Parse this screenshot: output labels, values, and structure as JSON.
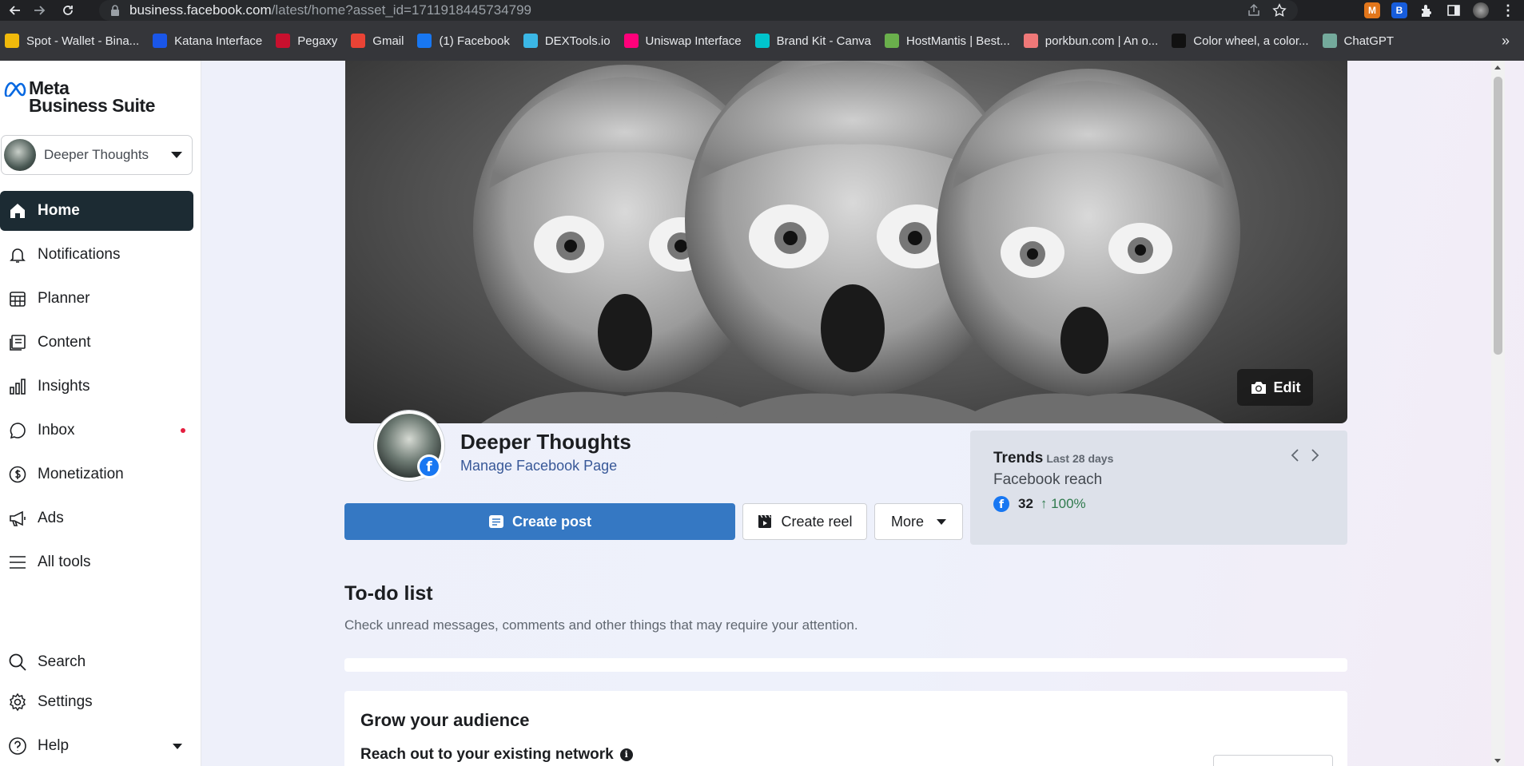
{
  "browser": {
    "url_host": "business.facebook.com",
    "url_path": "/latest/home?asset_id=1711918445734799",
    "bookmarks": [
      {
        "label": "Spot - Wallet - Bina...",
        "color": "#f0b90b",
        "icon": "binance-icon"
      },
      {
        "label": "Katana Interface",
        "color": "#1a56e8",
        "icon": "katana-icon"
      },
      {
        "label": "Pegaxy",
        "color": "#c8102e",
        "icon": "pegaxy-icon"
      },
      {
        "label": "Gmail",
        "color": "#ea4335",
        "icon": "gmail-icon"
      },
      {
        "label": "(1) Facebook",
        "color": "#1877f2",
        "icon": "facebook-icon"
      },
      {
        "label": "DEXTools.io",
        "color": "#3bb7e6",
        "icon": "dextools-icon"
      },
      {
        "label": "Uniswap Interface",
        "color": "#ff007a",
        "icon": "uniswap-icon"
      },
      {
        "label": "Brand Kit - Canva",
        "color": "#00c4cc",
        "icon": "canva-icon"
      },
      {
        "label": "HostMantis | Best...",
        "color": "#6ab04c",
        "icon": "hostmantis-icon"
      },
      {
        "label": "porkbun.com | An o...",
        "color": "#ef7878",
        "icon": "porkbun-icon"
      },
      {
        "label": "Color wheel, a color...",
        "color": "#111111",
        "icon": "colorwheel-icon"
      },
      {
        "label": "ChatGPT",
        "color": "#74aa9c",
        "icon": "chatgpt-icon"
      }
    ],
    "more_label": "»"
  },
  "sidebar": {
    "logo_line1": "Meta",
    "logo_line2": "Business Suite",
    "account_name": "Deeper Thoughts",
    "items": [
      {
        "label": "Home",
        "icon": "home-icon",
        "active": true
      },
      {
        "label": "Notifications",
        "icon": "bell-icon"
      },
      {
        "label": "Planner",
        "icon": "calendar-icon"
      },
      {
        "label": "Content",
        "icon": "content-icon"
      },
      {
        "label": "Insights",
        "icon": "bar-chart-icon"
      },
      {
        "label": "Inbox",
        "icon": "chat-icon",
        "badge": true
      },
      {
        "label": "Monetization",
        "icon": "dollar-icon"
      },
      {
        "label": "Ads",
        "icon": "megaphone-icon"
      },
      {
        "label": "All tools",
        "icon": "menu-icon"
      }
    ],
    "bottom_items": [
      {
        "label": "Search",
        "icon": "search-icon"
      },
      {
        "label": "Settings",
        "icon": "gear-icon"
      },
      {
        "label": "Help",
        "icon": "help-icon"
      }
    ]
  },
  "main": {
    "cover_edit_label": "Edit",
    "page_name": "Deeper Thoughts",
    "manage_link": "Manage Facebook Page",
    "create_post_label": "Create post",
    "create_reel_label": "Create reel",
    "more_label": "More",
    "trends": {
      "title": "Trends",
      "period": "Last 28 days",
      "metric": "Facebook reach",
      "value": "32",
      "change": "100%"
    },
    "todo": {
      "title": "To-do list",
      "subtitle": "Check unread messages, comments and other things that may require your attention."
    },
    "grow": {
      "title": "Grow your audience",
      "subtitle": "Reach out to your existing network"
    }
  },
  "colors": {
    "accent": "#3578c3",
    "active_nav": "#1c2b33",
    "facebook_blue": "#1877f2",
    "trend_up": "#2f7a4d"
  }
}
